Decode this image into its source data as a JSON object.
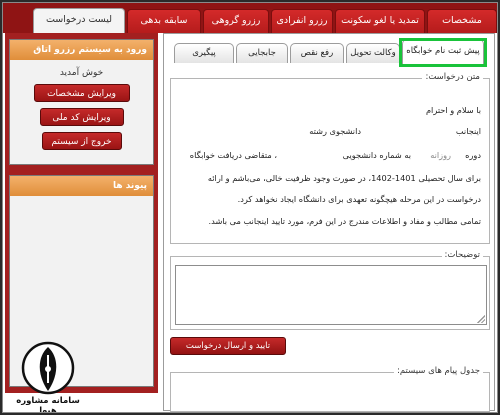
{
  "top_tabs": [
    {
      "label": "مشخصات",
      "active": false
    },
    {
      "label": "تمدید یا لغو سکونت",
      "active": false
    },
    {
      "label": "رزرو انفرادی",
      "active": false
    },
    {
      "label": "رزرو گروهی",
      "active": false
    },
    {
      "label": "سابقه بدهی",
      "active": false
    },
    {
      "label": "لیست درخواست",
      "active": true
    }
  ],
  "sidebar": {
    "login_box_title": "ورود به سیستم رزرو اتاق",
    "welcome": "خوش آمدید",
    "buttons": [
      "ویرایش مشخصات",
      "ویرایش کد ملی",
      "خروج از سیستم"
    ],
    "links_box_title": "پیوند ها"
  },
  "sub_tabs": [
    {
      "label": "پیش ثبت نام خوابگاه",
      "active": true
    },
    {
      "label": "وکالت تحویل",
      "active": false
    },
    {
      "label": "رفع نقص",
      "active": false
    },
    {
      "label": "جابجایی",
      "active": false
    },
    {
      "label": "پیگیری",
      "active": false
    }
  ],
  "request": {
    "legend": "متن درخواست:",
    "greeting": "با سلام و احترام",
    "line2_a": "اینجانب",
    "line2_b": "دانشجوی رشته",
    "line3_a": "دوره",
    "line3_period": "روزانه",
    "line3_b": "به شماره دانشجویی",
    "line3_c": "، متقاضی دریافت خوابگاه",
    "line4": "برای سال تحصیلی 1401-1402، در صورت وجود ظرفیت خالی، می‌باشم و ارائه",
    "line5": "درخواست در این مرحله هیچگونه تعهدی برای دانشگاه ایجاد نخواهد کرد.",
    "line6": "تمامی مطالب و مفاد و اطلاعات مندرج در این فرم، مورد تایید اینجانب می باشد."
  },
  "notes": {
    "legend": "توضیحات:",
    "value": ""
  },
  "submit_label": "تایید و ارسال درخواست",
  "messages": {
    "legend": "جدول پیام های سیستم:"
  },
  "watermark": {
    "text": "سامانه مشاوره هپوا"
  },
  "colors": {
    "primary_red": "#a32020",
    "accent_orange": "#e08e3a",
    "highlight_green": "#19c33a"
  }
}
